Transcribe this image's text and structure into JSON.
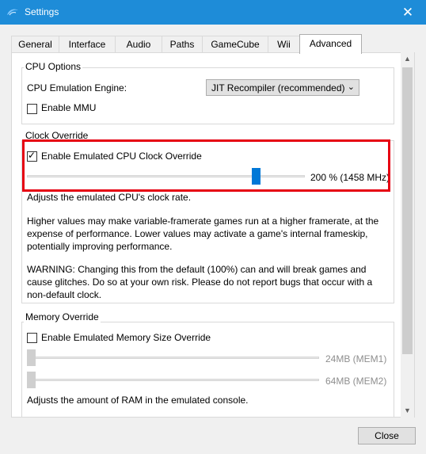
{
  "window": {
    "title": "Settings",
    "accent": "#1e8cd8"
  },
  "tabs": [
    {
      "label": "General"
    },
    {
      "label": "Interface"
    },
    {
      "label": "Audio"
    },
    {
      "label": "Paths"
    },
    {
      "label": "GameCube"
    },
    {
      "label": "Wii"
    },
    {
      "label": "Advanced",
      "active": true
    }
  ],
  "cpu_options": {
    "title": "CPU Options",
    "engine_label": "CPU Emulation Engine:",
    "engine_value": "JIT Recompiler (recommended)",
    "mmu_label": "Enable MMU",
    "mmu_checked": false
  },
  "clock_override": {
    "title": "Clock Override",
    "enable_label": "Enable Emulated CPU Clock Override",
    "enable_checked": true,
    "slider_value_text": "200 % (1458 MHz)",
    "slider_percent": 200,
    "desc1": "Adjusts the emulated CPU's clock rate.",
    "desc2_l1": "Higher values may make variable-framerate games run at a higher framerate, at the",
    "desc2_l2": "expense of performance. Lower values may activate a game's internal frameskip,",
    "desc2_l3": "potentially improving performance.",
    "desc3_l1": "WARNING: Changing this from the default (100%) can and will break games and",
    "desc3_l2": "cause glitches. Do so at your own risk. Please do not report bugs that occur with a",
    "desc3_l3": "non-default clock.",
    "highlight_color": "#e60012"
  },
  "memory_override": {
    "title": "Memory Override",
    "enable_label": "Enable Emulated Memory Size Override",
    "enable_checked": false,
    "mem1_text": "24MB (MEM1)",
    "mem2_text": "64MB (MEM2)",
    "desc": "Adjusts the amount of RAM in the emulated console."
  },
  "footer": {
    "close_label": "Close"
  }
}
